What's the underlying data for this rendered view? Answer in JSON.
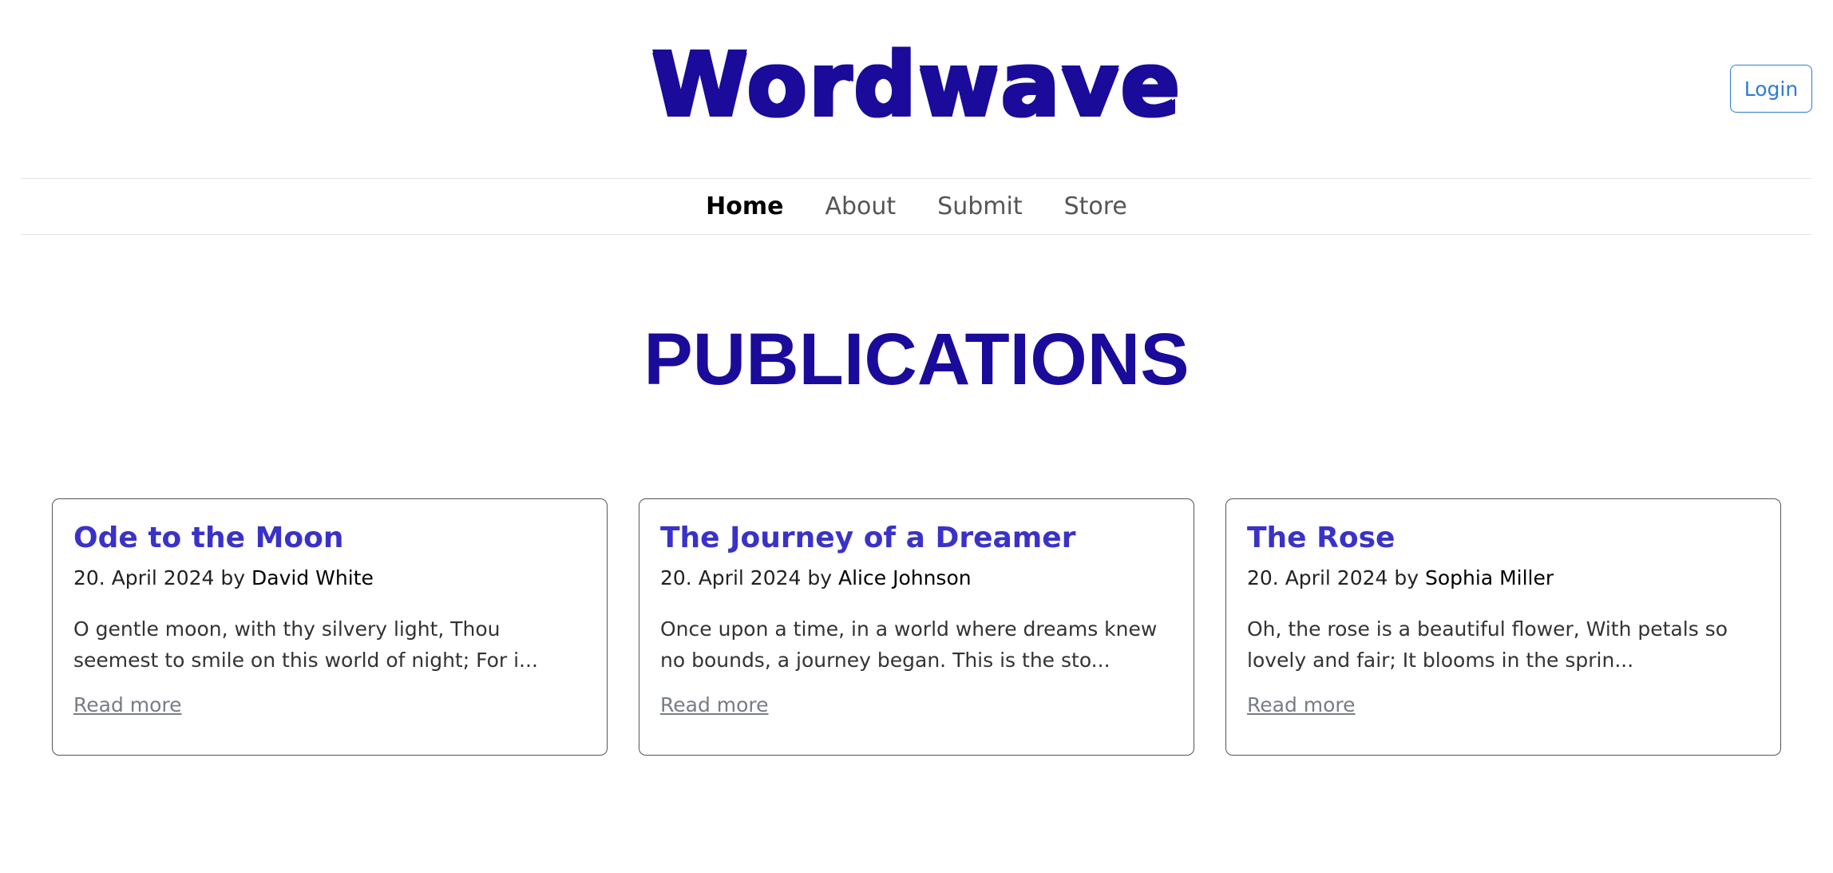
{
  "header": {
    "logo_text": "Wordwave",
    "login_label": "Login"
  },
  "nav": {
    "items": [
      {
        "label": "Home",
        "active": true
      },
      {
        "label": "About",
        "active": false
      },
      {
        "label": "Submit",
        "active": false
      },
      {
        "label": "Store",
        "active": false
      }
    ]
  },
  "main": {
    "title": "PUBLICATIONS",
    "cards": [
      {
        "title": "Ode to the Moon",
        "date": "20. April 2024",
        "by": "by",
        "author": "David White",
        "excerpt": "O gentle moon, with thy silvery light, Thou seemest to smile on this world of night; For i...",
        "link": "Read more"
      },
      {
        "title": "The Journey of a Dreamer",
        "date": "20. April 2024",
        "by": "by",
        "author": "Alice Johnson",
        "excerpt": "Once upon a time, in a world where dreams knew no bounds, a journey began. This is the sto...",
        "link": "Read more"
      },
      {
        "title": "The Rose",
        "date": "20. April 2024",
        "by": "by",
        "author": "Sophia Miller",
        "excerpt": "Oh, the rose is a beautiful flower, With petals so lovely and fair; It blooms in the sprin...",
        "link": "Read more"
      }
    ]
  },
  "colors": {
    "brand": "#1a0b9b",
    "card_title": "#3a32c8",
    "login_accent": "#2f7bd8",
    "link": "#777c85"
  }
}
